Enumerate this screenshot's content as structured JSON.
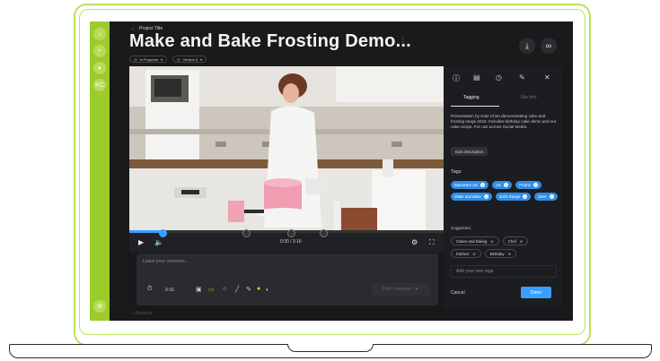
{
  "header": {
    "breadcrumb": "Project Title",
    "title": "Make and Bake Frosting Demo...",
    "status_chip": "In Progress",
    "version_chip": "Version 3"
  },
  "player": {
    "timecode": "0:30 / 3:16"
  },
  "comment": {
    "placeholder": "Leave your comment...",
    "time": "0:16",
    "post_label": "Post comment"
  },
  "footer": {
    "hint": "Shortcut"
  },
  "panel": {
    "tabs": [
      "info-icon",
      "list-icon",
      "clock-icon",
      "edit-icon",
      "close-icon"
    ],
    "subtab_active": "Tagging",
    "subtab_other": "File info",
    "description": "Presentation by Kate Chen demonstrating cake and frosting range 2023. Includes birthday cake demo and our cake recipe. For use across Social Media.",
    "edit_label": "Edit description",
    "tags_title": "Tags",
    "tags": [
      "Bakeware UK",
      "UK",
      "Promo",
      "Make and Bake",
      "2023 Range",
      "SMA"
    ],
    "suggested_title": "Suggested",
    "suggested": [
      "Cakes and baking",
      "Chef",
      "Kitchen",
      "Birthday"
    ],
    "own_placeholder": "Add your own tags",
    "cancel_label": "Cancel",
    "done_label": "Done"
  },
  "colors": {
    "accent_green": "#9ccc2c",
    "accent_blue": "#3aa0ff",
    "screen_bg": "#18191b"
  }
}
